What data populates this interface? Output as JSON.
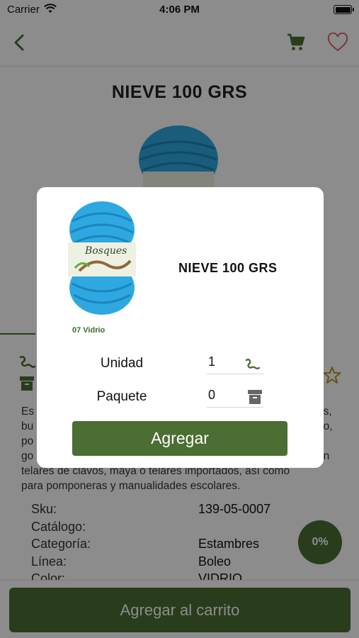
{
  "status_bar": {
    "carrier": "Carrier",
    "time": "4:06 PM"
  },
  "nav": {
    "back_icon": "chevron-left-icon",
    "cart_icon": "cart-icon",
    "favorite_icon": "heart-icon"
  },
  "product": {
    "title": "NIEVE 100 GRS",
    "description_lines": [
      "Es",
      "bu",
      "po",
      "go",
      "telares de clavos, maya o telares importados, así como",
      "para pomponeras y manualidades escolares."
    ],
    "description_right_fragments": [
      "as,",
      "no,",
      "",
      "en"
    ],
    "specs": [
      {
        "key": "Sku:",
        "value": "139-05-0007"
      },
      {
        "key": "Catálogo:",
        "value": ""
      },
      {
        "key": "Categoría:",
        "value": "Estambres"
      },
      {
        "key": "Línea:",
        "value": "Boleo"
      },
      {
        "key": "Color:",
        "value": "VIDRIO"
      }
    ],
    "discount": "0%",
    "add_to_cart_label": "Agregar al carrito"
  },
  "modal": {
    "title": "NIEVE 100 GRS",
    "yarn_brand": "Bosques",
    "yarn_caption": "07 Vidrio",
    "unit_label": "Unidad",
    "unit_value": "1",
    "package_label": "Paquete",
    "package_value": "0",
    "add_label": "Agregar"
  },
  "colors": {
    "primary": "#4b6e33",
    "yarn": "#2ea8e0",
    "heart": "#d96a6a",
    "star": "#b8952a"
  }
}
